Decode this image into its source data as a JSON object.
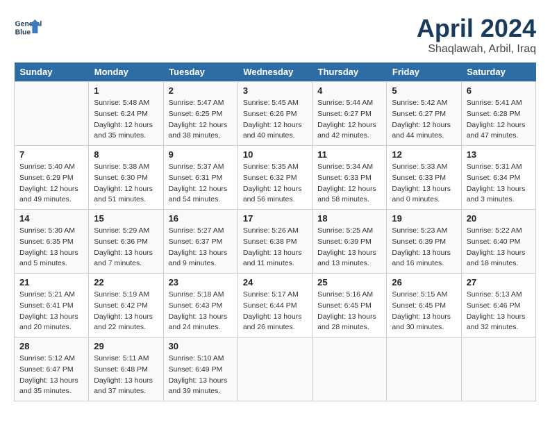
{
  "header": {
    "logo_line1": "General",
    "logo_line2": "Blue",
    "month_title": "April 2024",
    "subtitle": "Shaqlawah, Arbil, Iraq"
  },
  "days_of_week": [
    "Sunday",
    "Monday",
    "Tuesday",
    "Wednesday",
    "Thursday",
    "Friday",
    "Saturday"
  ],
  "weeks": [
    [
      {
        "day": "",
        "info": ""
      },
      {
        "day": "1",
        "info": "Sunrise: 5:48 AM\nSunset: 6:24 PM\nDaylight: 12 hours\nand 35 minutes."
      },
      {
        "day": "2",
        "info": "Sunrise: 5:47 AM\nSunset: 6:25 PM\nDaylight: 12 hours\nand 38 minutes."
      },
      {
        "day": "3",
        "info": "Sunrise: 5:45 AM\nSunset: 6:26 PM\nDaylight: 12 hours\nand 40 minutes."
      },
      {
        "day": "4",
        "info": "Sunrise: 5:44 AM\nSunset: 6:27 PM\nDaylight: 12 hours\nand 42 minutes."
      },
      {
        "day": "5",
        "info": "Sunrise: 5:42 AM\nSunset: 6:27 PM\nDaylight: 12 hours\nand 44 minutes."
      },
      {
        "day": "6",
        "info": "Sunrise: 5:41 AM\nSunset: 6:28 PM\nDaylight: 12 hours\nand 47 minutes."
      }
    ],
    [
      {
        "day": "7",
        "info": "Sunrise: 5:40 AM\nSunset: 6:29 PM\nDaylight: 12 hours\nand 49 minutes."
      },
      {
        "day": "8",
        "info": "Sunrise: 5:38 AM\nSunset: 6:30 PM\nDaylight: 12 hours\nand 51 minutes."
      },
      {
        "day": "9",
        "info": "Sunrise: 5:37 AM\nSunset: 6:31 PM\nDaylight: 12 hours\nand 54 minutes."
      },
      {
        "day": "10",
        "info": "Sunrise: 5:35 AM\nSunset: 6:32 PM\nDaylight: 12 hours\nand 56 minutes."
      },
      {
        "day": "11",
        "info": "Sunrise: 5:34 AM\nSunset: 6:33 PM\nDaylight: 12 hours\nand 58 minutes."
      },
      {
        "day": "12",
        "info": "Sunrise: 5:33 AM\nSunset: 6:33 PM\nDaylight: 13 hours\nand 0 minutes."
      },
      {
        "day": "13",
        "info": "Sunrise: 5:31 AM\nSunset: 6:34 PM\nDaylight: 13 hours\nand 3 minutes."
      }
    ],
    [
      {
        "day": "14",
        "info": "Sunrise: 5:30 AM\nSunset: 6:35 PM\nDaylight: 13 hours\nand 5 minutes."
      },
      {
        "day": "15",
        "info": "Sunrise: 5:29 AM\nSunset: 6:36 PM\nDaylight: 13 hours\nand 7 minutes."
      },
      {
        "day": "16",
        "info": "Sunrise: 5:27 AM\nSunset: 6:37 PM\nDaylight: 13 hours\nand 9 minutes."
      },
      {
        "day": "17",
        "info": "Sunrise: 5:26 AM\nSunset: 6:38 PM\nDaylight: 13 hours\nand 11 minutes."
      },
      {
        "day": "18",
        "info": "Sunrise: 5:25 AM\nSunset: 6:39 PM\nDaylight: 13 hours\nand 13 minutes."
      },
      {
        "day": "19",
        "info": "Sunrise: 5:23 AM\nSunset: 6:39 PM\nDaylight: 13 hours\nand 16 minutes."
      },
      {
        "day": "20",
        "info": "Sunrise: 5:22 AM\nSunset: 6:40 PM\nDaylight: 13 hours\nand 18 minutes."
      }
    ],
    [
      {
        "day": "21",
        "info": "Sunrise: 5:21 AM\nSunset: 6:41 PM\nDaylight: 13 hours\nand 20 minutes."
      },
      {
        "day": "22",
        "info": "Sunrise: 5:19 AM\nSunset: 6:42 PM\nDaylight: 13 hours\nand 22 minutes."
      },
      {
        "day": "23",
        "info": "Sunrise: 5:18 AM\nSunset: 6:43 PM\nDaylight: 13 hours\nand 24 minutes."
      },
      {
        "day": "24",
        "info": "Sunrise: 5:17 AM\nSunset: 6:44 PM\nDaylight: 13 hours\nand 26 minutes."
      },
      {
        "day": "25",
        "info": "Sunrise: 5:16 AM\nSunset: 6:45 PM\nDaylight: 13 hours\nand 28 minutes."
      },
      {
        "day": "26",
        "info": "Sunrise: 5:15 AM\nSunset: 6:45 PM\nDaylight: 13 hours\nand 30 minutes."
      },
      {
        "day": "27",
        "info": "Sunrise: 5:13 AM\nSunset: 6:46 PM\nDaylight: 13 hours\nand 32 minutes."
      }
    ],
    [
      {
        "day": "28",
        "info": "Sunrise: 5:12 AM\nSunset: 6:47 PM\nDaylight: 13 hours\nand 35 minutes."
      },
      {
        "day": "29",
        "info": "Sunrise: 5:11 AM\nSunset: 6:48 PM\nDaylight: 13 hours\nand 37 minutes."
      },
      {
        "day": "30",
        "info": "Sunrise: 5:10 AM\nSunset: 6:49 PM\nDaylight: 13 hours\nand 39 minutes."
      },
      {
        "day": "",
        "info": ""
      },
      {
        "day": "",
        "info": ""
      },
      {
        "day": "",
        "info": ""
      },
      {
        "day": "",
        "info": ""
      }
    ]
  ]
}
